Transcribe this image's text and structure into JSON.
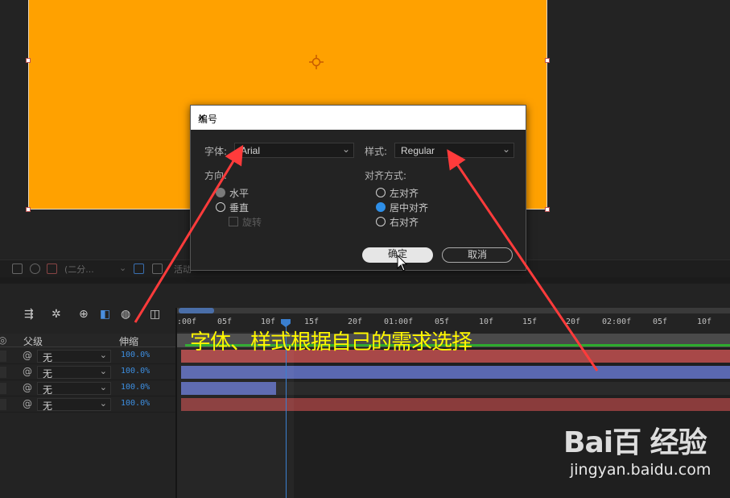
{
  "dialog": {
    "title": "编号",
    "font_label": "字体:",
    "font_value": "Arial",
    "style_label": "样式:",
    "style_value": "Regular",
    "direction_label": "方向:",
    "direction_options": [
      "水平",
      "垂直"
    ],
    "rotate_label": "旋转",
    "align_label": "对齐方式:",
    "align_options": [
      "左对齐",
      "居中对齐",
      "右对齐"
    ],
    "ok_label": "确定",
    "cancel_label": "取消"
  },
  "viewer": {
    "resolution_label": "(二分...",
    "resolution_suffix": "活动"
  },
  "timeline": {
    "col_parent": "父级",
    "col_stretch": "伸缩",
    "layers": [
      {
        "parent": "无",
        "stretch": "100.0%"
      },
      {
        "parent": "无",
        "stretch": "100.0%"
      },
      {
        "parent": "无",
        "stretch": "100.0%"
      },
      {
        "parent": "无",
        "stretch": "100.0%"
      }
    ],
    "ruler_ticks": [
      ":00f",
      "05f",
      "10f",
      "15f",
      "20f",
      "01:00f",
      "05f",
      "10f",
      "15f",
      "20f",
      "02:00f",
      "05f",
      "10f"
    ]
  },
  "annotation": "字体、样式根据自己的需求选择",
  "watermark": {
    "logo": "Bai百 经验",
    "url": "jingyan.baidu.com"
  },
  "colors": {
    "comp_bg": "#ffa100",
    "accent_blue": "#2e8fe8",
    "annotation_yellow": "#fff700",
    "arrow_red": "#ff3b3b",
    "bar_red": "#a84848",
    "bar_blue": "#5a68b0"
  }
}
